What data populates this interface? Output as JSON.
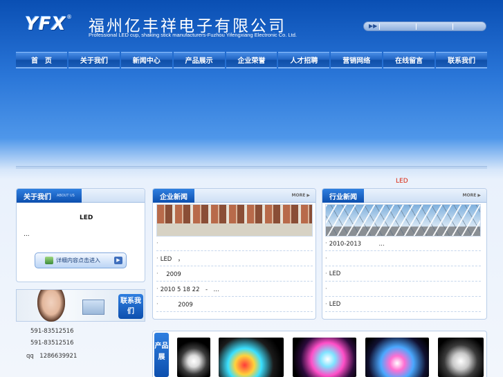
{
  "header": {
    "logo_text": "YFX",
    "logo_mark": "®",
    "company_cn": "福州亿丰祥电子有限公司",
    "company_en": "Professional LED cup, shaking stick manufacturers-Fuzhou Yifengxiang Electronic Co. Ltd.",
    "player_icon": "play-forward-icon"
  },
  "nav": {
    "items": [
      "首　页",
      "关于我们",
      "新闻中心",
      "产品展示",
      "企业荣誉",
      "人才招聘",
      "营销网络",
      "在线留言",
      "联系我们"
    ]
  },
  "marquee": {
    "text": "LED"
  },
  "about": {
    "title": "关于我们",
    "subtitle": "ABOUT US",
    "heading": "LED",
    "ellipsis": "...",
    "button_label": "详细内容点击进入"
  },
  "contact": {
    "badge": "联系我们",
    "lines": [
      "591-83512516",
      "591-83512516",
      "qq　1286639921"
    ]
  },
  "company_news": {
    "title": "企业新闻",
    "more": "MORE",
    "items": [
      "",
      "LED　，",
      "　2009",
      "2010 5 18 22　-　...",
      "　　　2009"
    ]
  },
  "industry_news": {
    "title": "行业新闻",
    "more": "MORE",
    "items": [
      "2010-2013　　　...",
      "",
      "LED",
      "",
      "LED"
    ]
  },
  "products": {
    "label": "产品展"
  },
  "colors": {
    "brand_blue": "#0d4fae",
    "accent_red": "#d81e06"
  }
}
